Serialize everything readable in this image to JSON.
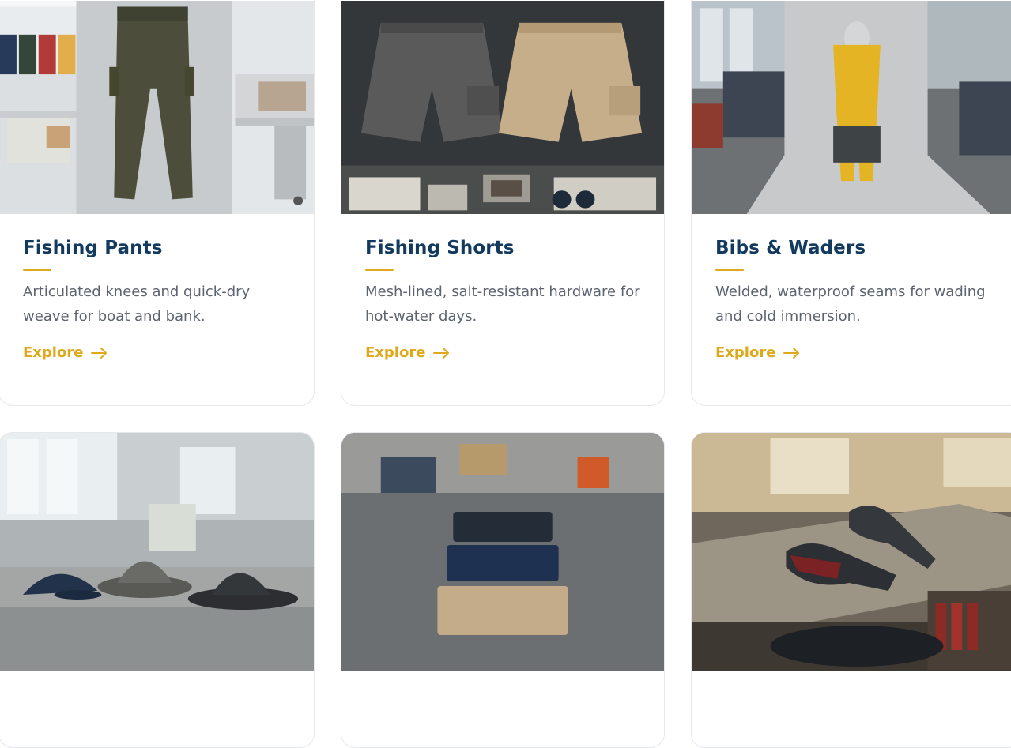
{
  "colors": {
    "title": "#12395e",
    "accent": "#e0a91c",
    "text": "#5c6470",
    "card_border": "#e6e8ec"
  },
  "cards": [
    {
      "title": "Fishing Pants",
      "description": "Articulated knees and quick-dry weave for boat and bank.",
      "link": "Explore",
      "image_alt": "Olive fishing pants on a grey panel in a sewing workshop"
    },
    {
      "title": "Fishing Shorts",
      "description": "Mesh-lined, salt-resistant hardware for hot-water days.",
      "link": "Explore",
      "image_alt": "Grey and khaki cargo shorts above sewing machines"
    },
    {
      "title": "Bibs & Waders",
      "description": "Welded, waterproof seams for wading and cold immersion.",
      "link": "Explore",
      "image_alt": "Yellow and grey bibs on a mannequin in a factory"
    },
    {
      "image_alt": "Three fishing hats on a concrete table in a factory"
    },
    {
      "image_alt": "Folded navy and tan fabric pieces on a concrete table"
    },
    {
      "image_alt": "Neoprene fishing gloves on a workbench"
    }
  ]
}
